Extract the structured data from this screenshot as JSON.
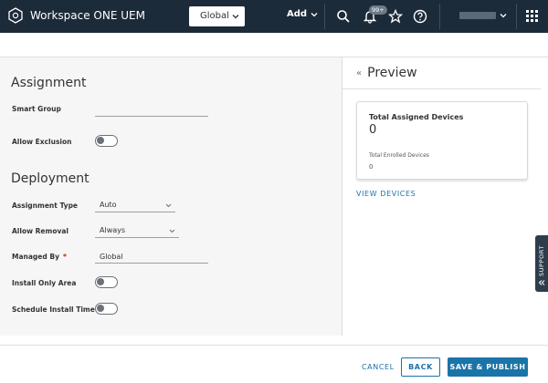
{
  "header": {
    "app_title": "Workspace ONE UEM",
    "org_selector": "Global",
    "add_label": "Add",
    "notification_badge": "99+",
    "icons": [
      "search-icon",
      "bell-icon",
      "star-icon",
      "help-icon",
      "apps-grid-icon"
    ]
  },
  "assignment": {
    "title": "Assignment",
    "smart_group_label": "Smart Group",
    "smart_group_value": "",
    "allow_exclusion_label": "Allow Exclusion",
    "allow_exclusion_on": false
  },
  "deployment": {
    "title": "Deployment",
    "assignment_type_label": "Assignment Type",
    "assignment_type_value": "Auto",
    "allow_removal_label": "Allow Removal",
    "allow_removal_value": "Always",
    "managed_by_label": "Managed By",
    "managed_by_required": "*",
    "managed_by_value": "Global",
    "install_only_area_label": "Install Only Area",
    "install_only_area_on": false,
    "schedule_install_time_label": "Schedule Install Time",
    "schedule_install_time_on": false
  },
  "preview": {
    "title": "Preview",
    "card_title": "Total Assigned Devices",
    "card_value": "0",
    "card_sub_label": "Total Enrolled Devices",
    "card_sub_value": "0",
    "link": "VIEW DEVICES"
  },
  "support_tab": "SUPPORT",
  "footer": {
    "cancel": "CANCEL",
    "back": "BACK",
    "save": "SAVE & PUBLISH"
  },
  "colors": {
    "header_bg": "#1c2b3a",
    "accent": "#1a74a8",
    "panel_bg": "#f6f6f7"
  }
}
